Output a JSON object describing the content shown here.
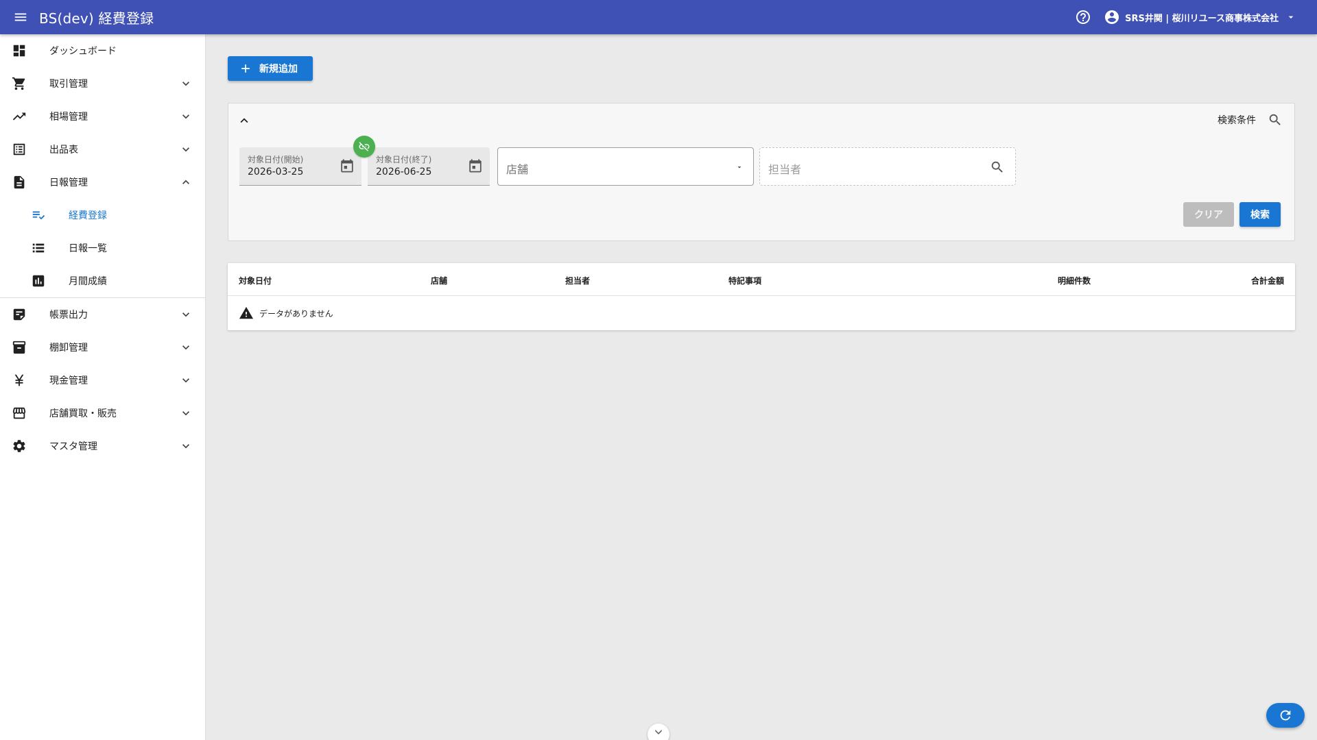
{
  "appbar": {
    "title": "BS(dev) 経費登録",
    "user_label": "SRS井関 | 桜川リユース商事株式会社",
    "color": "#3f51b5"
  },
  "sidebar": {
    "items": [
      {
        "label": "ダッシュボード",
        "icon": "dashboard-icon"
      },
      {
        "label": "取引管理",
        "icon": "cart-icon"
      },
      {
        "label": "相場管理",
        "icon": "trending-up-icon"
      },
      {
        "label": "出品表",
        "icon": "list-alt-icon"
      },
      {
        "label": "日報管理",
        "icon": "description-icon",
        "expanded": true
      }
    ],
    "sub_items": [
      {
        "label": "経費登録",
        "icon": "edit-note-icon",
        "active": true
      },
      {
        "label": "日報一覧",
        "icon": "view-list-icon"
      },
      {
        "label": "月間成績",
        "icon": "assessment-icon"
      }
    ],
    "items_after": [
      {
        "label": "帳票出力",
        "icon": "note-icon"
      },
      {
        "label": "棚卸管理",
        "icon": "archive-icon"
      },
      {
        "label": "現金管理",
        "icon": "yen-icon"
      },
      {
        "label": "店舗買取・販売",
        "icon": "store-icon"
      },
      {
        "label": "マスタ管理",
        "icon": "settings-icon"
      }
    ]
  },
  "main": {
    "add_button_label": "新規追加",
    "search": {
      "conditions_label": "検索条件",
      "date_start_label": "対象日付(開始)",
      "date_start_value": "2026-03-25",
      "date_end_label": "対象日付(終了)",
      "date_end_value": "2026-06-25",
      "store_placeholder": "店舗",
      "staff_placeholder": "担当者",
      "clear_label": "クリア",
      "search_label": "検索"
    },
    "table": {
      "columns": [
        "対象日付",
        "店舗",
        "担当者",
        "特記事項",
        "明細件数",
        "合計金額"
      ],
      "empty_message": "データがありません"
    }
  },
  "colors": {
    "primary": "#1976d2",
    "link_badge": "#4caf50",
    "disabled": "#bdbdbd"
  }
}
